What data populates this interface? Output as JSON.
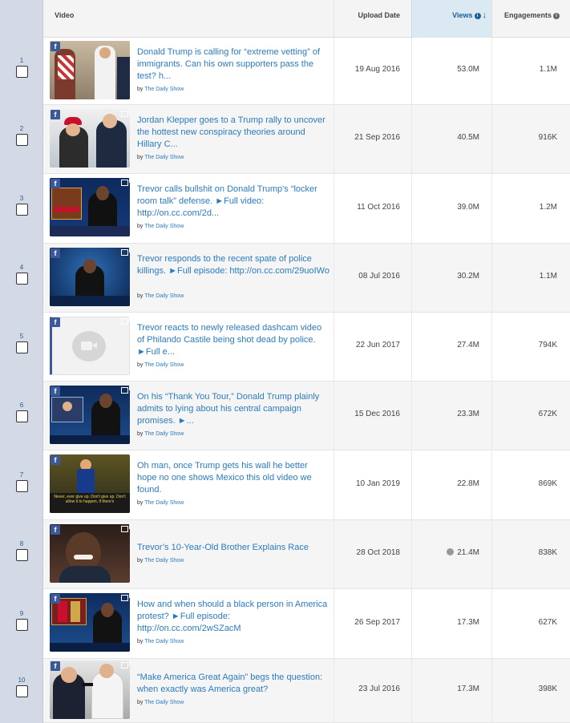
{
  "headers": {
    "video": "Video",
    "upload_date": "Upload Date",
    "views": "Views",
    "engagements": "Engagements"
  },
  "byline_prefix": "by",
  "rows": [
    {
      "rank": "1",
      "title": "Donald Trump is calling for “extreme vetting” of immigrants. Can his own supporters pass the test? h...",
      "channel": "The Daily Show",
      "date": "19 Aug 2016",
      "views": "53.0M",
      "engagements": "1.1M",
      "thumb": "rally-interview"
    },
    {
      "rank": "2",
      "title": "Jordan Klepper goes to a Trump rally to uncover the hottest new conspiracy theories around Hillary C...",
      "channel": "The Daily Show",
      "date": "21 Sep 2016",
      "views": "40.5M",
      "engagements": "916K",
      "thumb": "red-hat-interview"
    },
    {
      "rank": "3",
      "title": "Trevor calls bullshit on Donald Trump's “locker room talk” defense. ►Full video: http://on.cc.com/2d...",
      "channel": "The Daily Show",
      "date": "11 Oct 2016",
      "views": "39.0M",
      "engagements": "1.2M",
      "thumb": "studio-desk"
    },
    {
      "rank": "4",
      "title": "Trevor responds to the recent spate of police killings. ►Full episode: http://on.cc.com/29uoIWo",
      "channel": "The Daily Show",
      "date": "08 Jul 2016",
      "views": "30.2M",
      "engagements": "1.1M",
      "thumb": "studio-blue"
    },
    {
      "rank": "5",
      "title": "Trevor reacts to newly released dashcam video of Philando Castile being shot dead by police. ►Full e...",
      "channel": "The Daily Show",
      "date": "22 Jun 2017",
      "views": "27.4M",
      "engagements": "794K",
      "thumb": "placeholder"
    },
    {
      "rank": "6",
      "title": "On his “Thank You Tour,” Donald Trump plainly admits to lying about his central campaign promises. ►...",
      "channel": "The Daily Show",
      "date": "15 Dec 2016",
      "views": "23.3M",
      "engagements": "672K",
      "thumb": "studio-split"
    },
    {
      "rank": "7",
      "title": "Oh man, once Trump gets his wall he better hope no one shows Mexico this old video we found.",
      "channel": "The Daily Show",
      "date": "10 Jan 2019",
      "views": "22.8M",
      "engagements": "869K",
      "thumb": "graduation",
      "caption": "Never, ever give up. Don't give up. Don't allow it to happen, if there's"
    },
    {
      "rank": "8",
      "title": "Trevor’s 10-Year-Old Brother Explains Race",
      "channel": "The Daily Show",
      "date": "28 Oct 2018",
      "views": "21.4M",
      "engagements": "838K",
      "thumb": "closeup",
      "views_icon": "globe-icon"
    },
    {
      "rank": "9",
      "title": "How and when should a black person in America protest? ►Full episode: http://on.cc.com/2wSZacM",
      "channel": "The Daily Show",
      "date": "26 Sep 2017",
      "views": "17.3M",
      "engagements": "627K",
      "thumb": "studio-football"
    },
    {
      "rank": "10",
      "title": "“Make America Great Again” begs the question: when exactly was America great?",
      "channel": "The Daily Show",
      "date": "23 Jul 2016",
      "views": "17.3M",
      "engagements": "398K",
      "thumb": "street-interview"
    }
  ],
  "icons": {
    "facebook": "f",
    "sort": "↓",
    "info": "i"
  },
  "colors": {
    "link": "#2b7bbf",
    "facebook": "#3b5998",
    "rank_column": "#d3d9e5",
    "sorted_header": "#dbe9f3"
  }
}
